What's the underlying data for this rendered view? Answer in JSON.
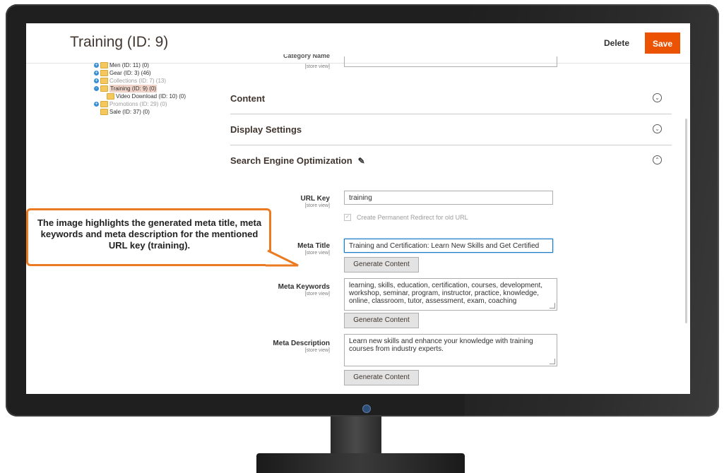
{
  "header": {
    "title": "Training (ID: 9)",
    "delete_label": "Delete",
    "save_label": "Save"
  },
  "tree": [
    {
      "label": "Men (ID: 11) (0)",
      "expander": "+",
      "state": "normal",
      "indent": 0
    },
    {
      "label": "Gear (ID: 3) (46)",
      "expander": "+",
      "state": "normal",
      "indent": 0
    },
    {
      "label": "Collections (ID: 7) (13)",
      "expander": "+",
      "state": "muted",
      "indent": 0
    },
    {
      "label": "Training (ID: 9) (0)",
      "expander": "-",
      "state": "selected",
      "indent": 0
    },
    {
      "label": "Video Download (ID: 10) (0)",
      "expander": "",
      "state": "normal",
      "indent": 1
    },
    {
      "label": "Promotions (ID: 29) (0)",
      "expander": "+",
      "state": "muted",
      "indent": 0
    },
    {
      "label": "Sale (ID: 37) (0)",
      "expander": "",
      "state": "normal",
      "indent": 0
    }
  ],
  "partial_field": {
    "label": "Category Name",
    "scope": "[store view]"
  },
  "sections": {
    "content": "Content",
    "display": "Display Settings",
    "seo": "Search Engine Optimization"
  },
  "seo": {
    "scope": "[store view]",
    "url_key": {
      "label": "URL Key",
      "value": "training"
    },
    "redirect": {
      "label": "Create Permanent Redirect for old URL",
      "checked": true
    },
    "meta_title": {
      "label": "Meta Title",
      "value": "Training and Certification: Learn New Skills and Get Certified"
    },
    "meta_keywords": {
      "label": "Meta Keywords",
      "value": "learning, skills, education, certification, courses, development, workshop, seminar, program, instructor, practice, knowledge, online, classroom, tutor, assessment, exam, coaching"
    },
    "meta_description": {
      "label": "Meta Description",
      "value": "Learn new skills and enhance your knowledge with training courses from industry experts."
    },
    "generate_label": "Generate Content"
  },
  "callout": {
    "text": "The image highlights the generated meta title, meta keywords and meta description for the mentioned URL key (training)."
  },
  "colors": {
    "accent": "#eb5202",
    "callout_border": "#eb7b21",
    "focus": "#1979c3"
  }
}
